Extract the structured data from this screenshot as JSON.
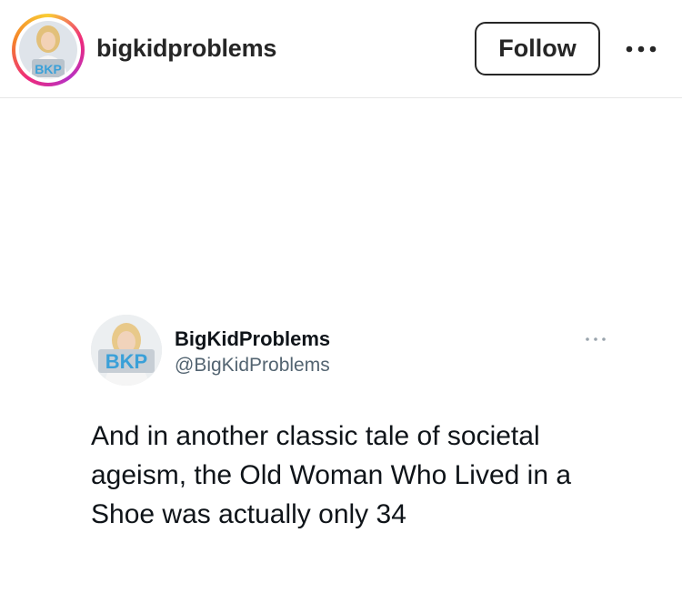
{
  "header": {
    "username": "bigkidproblems",
    "follow_label": "Follow",
    "avatar_logo_text": "BKP",
    "more_icon": "more-horizontal-icon"
  },
  "tweet": {
    "display_name": "BigKidProblems",
    "handle": "@BigKidProblems",
    "avatar_logo_text": "BKP",
    "body": "And in another classic tale of societal ageism, the Old Woman Who Lived in a Shoe was actually only 34",
    "more_icon": "more-horizontal-icon"
  },
  "colors": {
    "text_primary": "#262626",
    "tweet_text": "#0f1419",
    "handle_gray": "#536471",
    "logo_blue": "#3aa0d8",
    "story_ring": [
      "#f9ce34",
      "#ee2a7b",
      "#b731c4"
    ]
  }
}
